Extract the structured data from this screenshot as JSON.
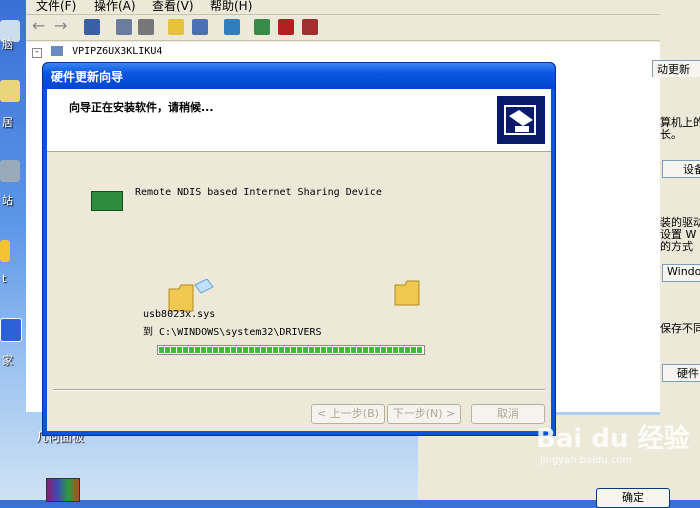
{
  "device_manager": {
    "menu": [
      "文件(F)",
      "操作(A)",
      "查看(V)",
      "帮助(H)"
    ],
    "tree_root": "VPIPZ6UX3KLIKU4"
  },
  "desktop": {
    "icon_labels": [
      "脑",
      "居",
      "站",
      "t",
      "家"
    ],
    "bottom_label": "几何面板"
  },
  "properties_dialog": {
    "tab": "动更新",
    "lines": [
      "算机上的",
      "长。",
      "设备",
      "装的驱动",
      "设置 W",
      "的方式",
      "Windo",
      "保存不同",
      "硬件"
    ],
    "ok_label": "确定"
  },
  "wizard": {
    "title": "硬件更新向导",
    "heading": "向导正在安装软件，请稍候...",
    "device_name": "Remote NDIS based Internet Sharing Device",
    "file_name": "usb8023x.sys",
    "destination": "到 C:\\WINDOWS\\system32\\DRIVERS",
    "progress": 1.0,
    "buttons": {
      "back": "< 上一步(B)",
      "next": "下一步(N) >",
      "cancel": "取消"
    }
  },
  "watermark": "Bai du 经验",
  "watermark_sub": "jingyan.baidu.com"
}
